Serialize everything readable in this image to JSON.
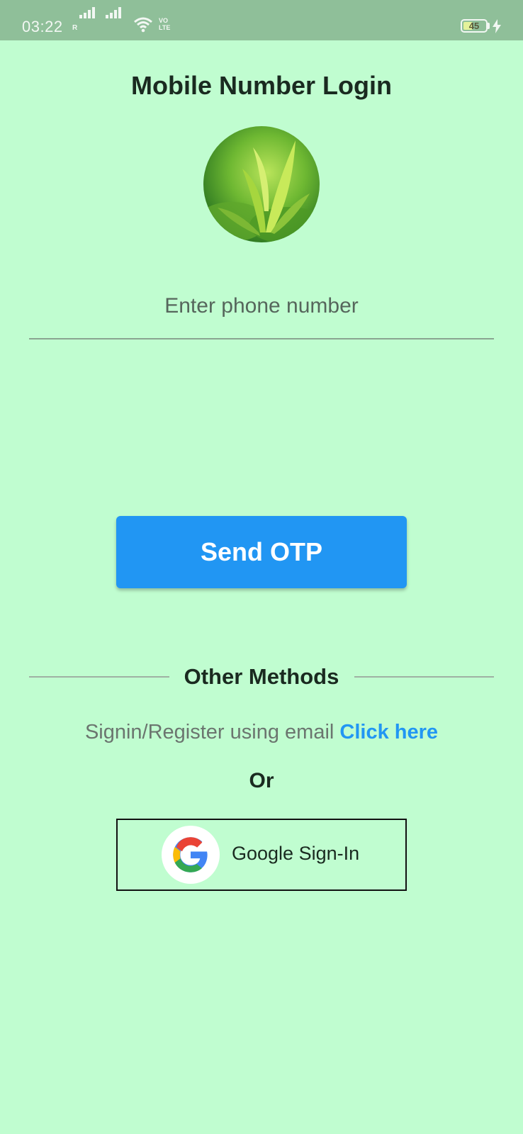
{
  "status_bar": {
    "time": "03:22",
    "roaming": "R",
    "volte": "VO\nLTE",
    "battery_level": "45",
    "battery_fraction": 0.45
  },
  "page": {
    "title": "Mobile Number Login"
  },
  "phone": {
    "placeholder": "Enter phone number",
    "value": ""
  },
  "send_otp": {
    "label": "Send OTP"
  },
  "other_methods": {
    "label": "Other Methods",
    "email_prompt": "Signin/Register using email",
    "email_link": "Click here",
    "or_label": "Or",
    "google_label": "Google Sign-In"
  },
  "colors": {
    "background": "#c0fdd0",
    "status_bar": "#8fbf99",
    "primary": "#2196f3",
    "text_dark": "#1a2a20"
  },
  "icons": {
    "logo": "tea-leaves-image",
    "google": "google-g-icon"
  }
}
